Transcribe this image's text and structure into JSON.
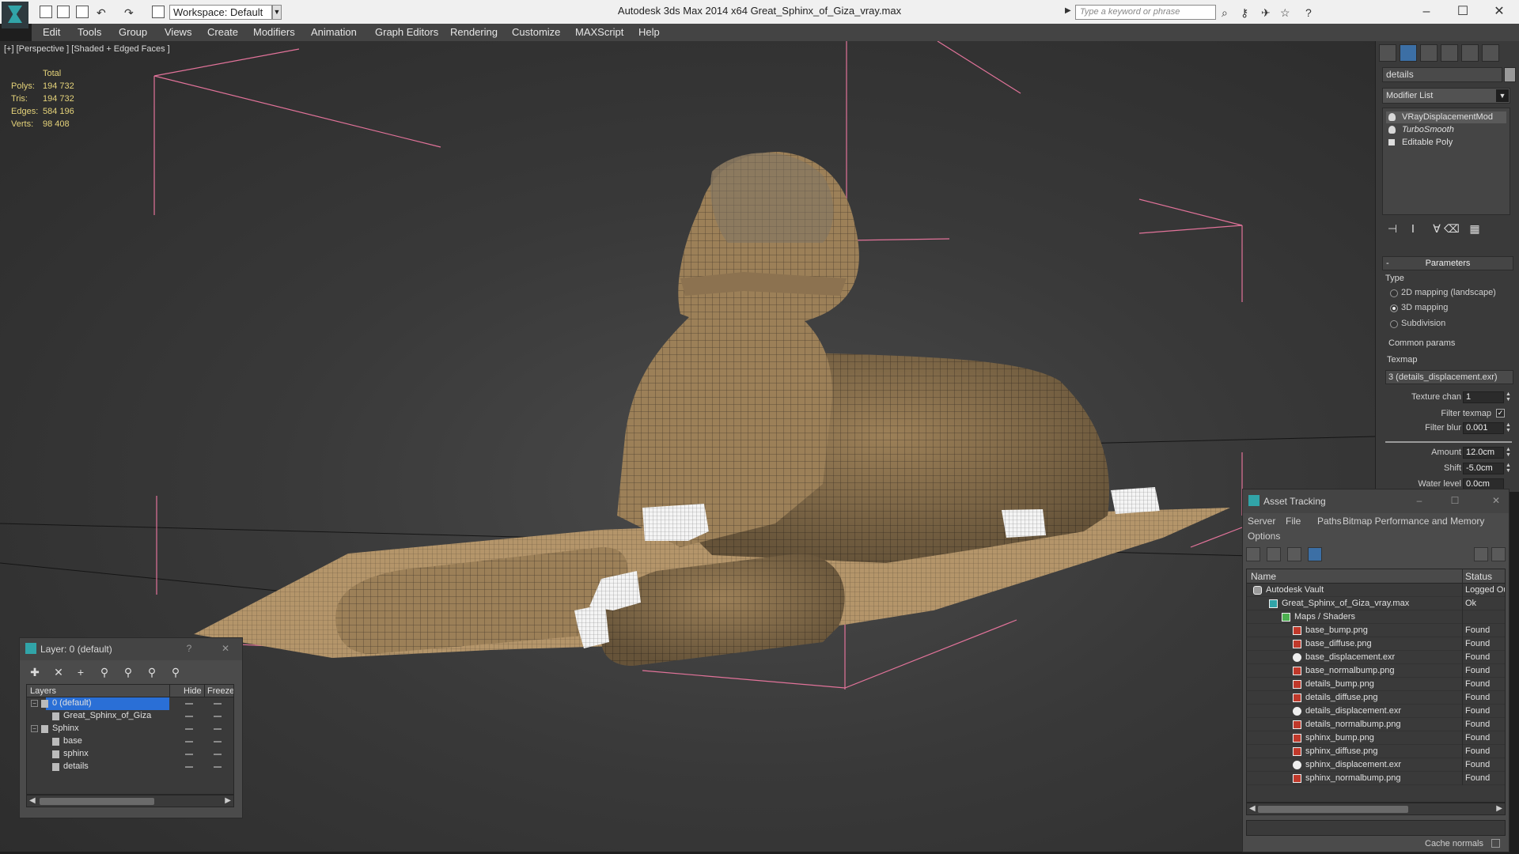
{
  "title_bar": {
    "app_title": "Autodesk 3ds Max  2014 x64      Great_Sphinx_of_Giza_vray.max",
    "workspace": "Workspace: Default",
    "search_placeholder": "Type a keyword or phrase"
  },
  "menu": [
    "Edit",
    "Tools",
    "Group",
    "Views",
    "Create",
    "Modifiers",
    "Animation",
    "Graph Editors",
    "Rendering",
    "Customize",
    "MAXScript",
    "Help"
  ],
  "viewport": {
    "label": "[+] [Perspective ] [Shaded + Edged Faces ]",
    "stats": {
      "header": "Total",
      "rows": [
        {
          "k": "Polys:",
          "v": "194 732"
        },
        {
          "k": "Tris:",
          "v": "194 732"
        },
        {
          "k": "Edges:",
          "v": "584 196"
        },
        {
          "k": "Verts:",
          "v": "98 408"
        }
      ]
    }
  },
  "command_panel": {
    "object_name": "details",
    "modifier_list": "Modifier List",
    "stack": [
      "VRayDisplacementMod",
      "TurboSmooth",
      "Editable Poly"
    ],
    "params_title": "Parameters",
    "type_label": "Type",
    "type_options": [
      "2D mapping (landscape)",
      "3D mapping",
      "Subdivision"
    ],
    "type_selected": "3D mapping",
    "common_params": "Common params",
    "texmap_label": "Texmap",
    "texmap_value": "3 (details_displacement.exr)",
    "texture_chan_label": "Texture chan",
    "texture_chan": "1",
    "filter_texmap_label": "Filter texmap",
    "filter_texmap_checked": "✓",
    "filter_blur_label": "Filter blur",
    "filter_blur": "0.001",
    "amount_label": "Amount",
    "amount": "12.0cm",
    "shift_label": "Shift",
    "shift": "-5.0cm",
    "water_level_label": "Water level",
    "water_level": "0.0cm"
  },
  "asset_tracking": {
    "title": "Asset Tracking",
    "menus": [
      "Server",
      "File",
      "Paths",
      "Bitmap Performance and Memory",
      "Options"
    ],
    "columns": [
      "Name",
      "Status"
    ],
    "rows": [
      {
        "name": "Autodesk Vault",
        "status": "Logged Out",
        "type": "vault"
      },
      {
        "name": "Great_Sphinx_of_Giza_vray.max",
        "status": "Ok",
        "type": "max"
      },
      {
        "name": "Maps / Shaders",
        "status": "",
        "type": "folder"
      },
      {
        "name": "base_bump.png",
        "status": "Found",
        "type": "png"
      },
      {
        "name": "base_diffuse.png",
        "status": "Found",
        "type": "png"
      },
      {
        "name": "base_displacement.exr",
        "status": "Found",
        "type": "exr"
      },
      {
        "name": "base_normalbump.png",
        "status": "Found",
        "type": "png"
      },
      {
        "name": "details_bump.png",
        "status": "Found",
        "type": "png"
      },
      {
        "name": "details_diffuse.png",
        "status": "Found",
        "type": "png"
      },
      {
        "name": "details_displacement.exr",
        "status": "Found",
        "type": "exr"
      },
      {
        "name": "details_normalbump.png",
        "status": "Found",
        "type": "png"
      },
      {
        "name": "sphinx_bump.png",
        "status": "Found",
        "type": "png"
      },
      {
        "name": "sphinx_diffuse.png",
        "status": "Found",
        "type": "png"
      },
      {
        "name": "sphinx_displacement.exr",
        "status": "Found",
        "type": "exr"
      },
      {
        "name": "sphinx_normalbump.png",
        "status": "Found",
        "type": "png"
      }
    ],
    "cache_normals": "Cache normals"
  },
  "layer_window": {
    "title": "Layer: 0 (default)",
    "columns": [
      "Layers",
      "Hide",
      "Freeze"
    ],
    "rows": [
      {
        "name": "0 (default)",
        "level": 0,
        "selected": true
      },
      {
        "name": "Great_Sphinx_of_Giza",
        "level": 1
      },
      {
        "name": "Sphinx",
        "level": 0
      },
      {
        "name": "base",
        "level": 1
      },
      {
        "name": "sphinx",
        "level": 1
      },
      {
        "name": "details",
        "level": 1
      }
    ]
  },
  "colors": {
    "bounding_box": "#e2739a",
    "stats_text": "#e5d37a",
    "selection": "#2a6fd6",
    "accent": "#31a4a8",
    "sphinx_stone": "#a0845a"
  }
}
